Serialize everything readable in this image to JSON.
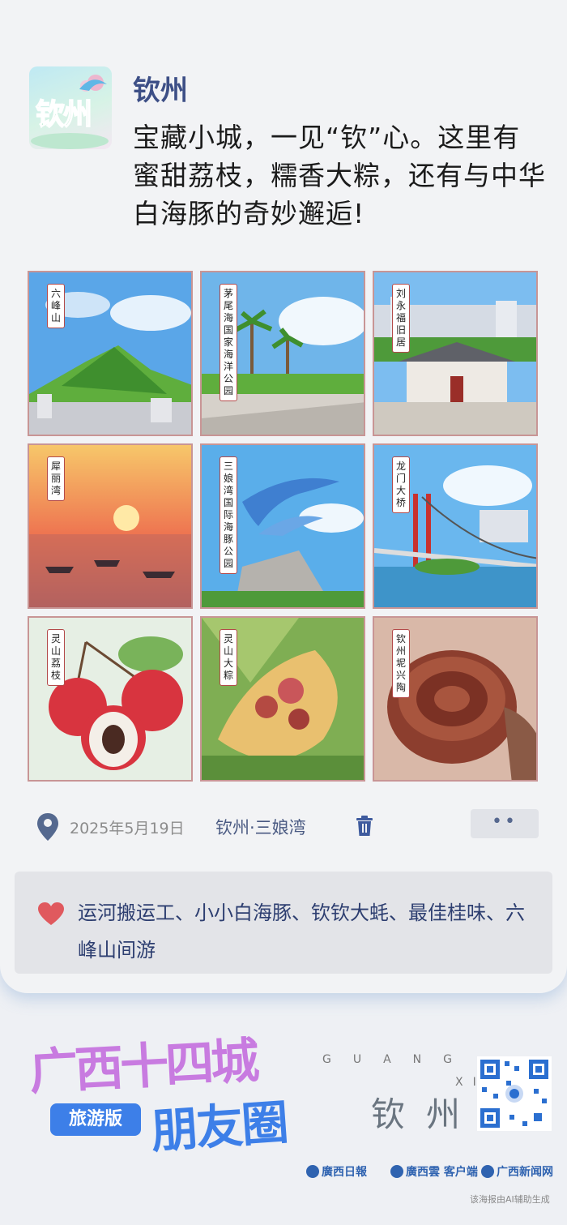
{
  "post": {
    "avatar_text": "钦州",
    "author": "钦州",
    "text": "宝藏小城，一见“钦”心。这里有蜜甜荔枝，糯香大粽，还有与中华白海豚的奇妙邂逅!"
  },
  "photos": [
    {
      "label": "六峰山"
    },
    {
      "label": "茅尾海国家海洋公园"
    },
    {
      "label": "刘永福旧居"
    },
    {
      "label": "犀丽湾"
    },
    {
      "label": "三娘湾国际海豚公园"
    },
    {
      "label": "龙门大桥"
    },
    {
      "label": "灵山荔枝"
    },
    {
      "label": "灵山大粽"
    },
    {
      "label": "钦州坭兴陶"
    }
  ],
  "meta": {
    "location_icon": "location-pin-icon",
    "date": "2025年5月19日",
    "place": "钦州·三娘湾",
    "delete_icon": "trash-icon",
    "more_label": "••"
  },
  "likes": {
    "icon": "heart-icon",
    "text": "运河搬运工、小小白海豚、钦钦大蚝、最佳桂味、六峰山间游"
  },
  "footer": {
    "logo_main": "广西十四城",
    "logo_sub": "朋友圈",
    "edition": "旅游版",
    "guang": "GUANG",
    "xi": "XI",
    "city": "钦州",
    "publishers": [
      "廣西日報",
      "廣西雲 客户端",
      "广西新闻网"
    ],
    "ai_note": "该海报由AI辅助生成"
  },
  "colors": {
    "author": "#3d4f86",
    "heart": "#e0595e",
    "logo_purple": "#c87be0",
    "logo_blue": "#3d7fe8"
  }
}
